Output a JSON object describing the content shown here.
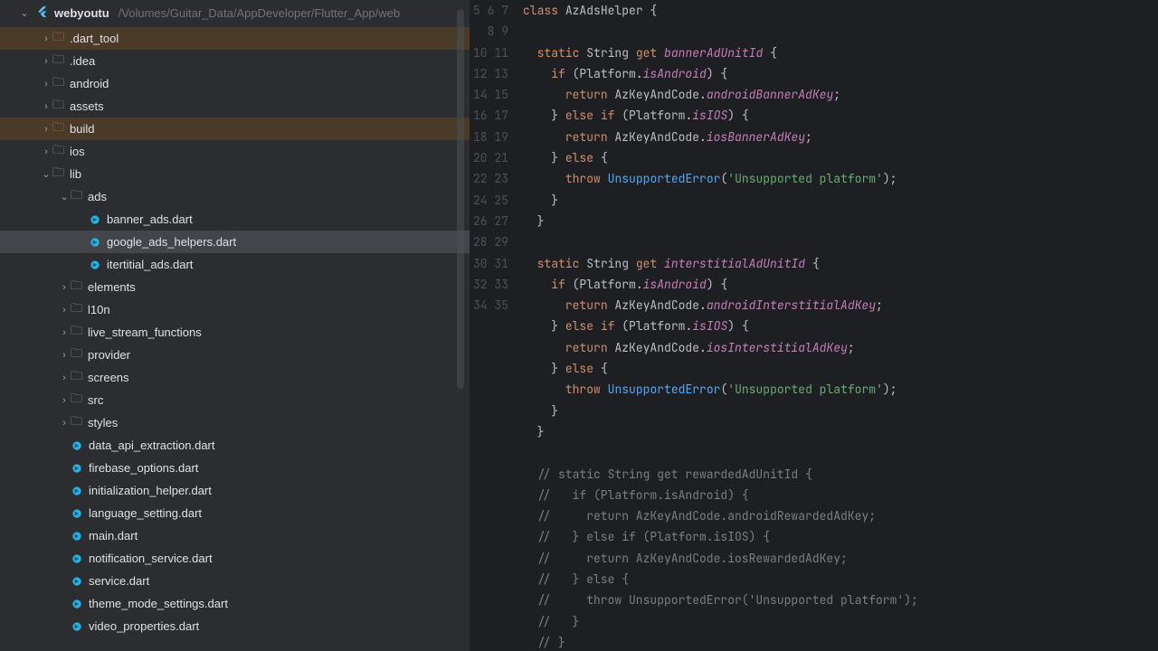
{
  "project": {
    "name": "webyoutu",
    "path": "/Volumes/Guitar_Data/AppDeveloper/Flutter_App/web"
  },
  "tree": [
    {
      "indent": 1,
      "chevron": "right",
      "icon": "folder-orange",
      "label": ".dart_tool",
      "highlight": "orange"
    },
    {
      "indent": 1,
      "chevron": "right",
      "icon": "folder",
      "label": ".idea"
    },
    {
      "indent": 1,
      "chevron": "right",
      "icon": "folder",
      "label": "android"
    },
    {
      "indent": 1,
      "chevron": "right",
      "icon": "folder",
      "label": "assets"
    },
    {
      "indent": 1,
      "chevron": "right",
      "icon": "folder-orange",
      "label": "build",
      "highlight": "orange"
    },
    {
      "indent": 1,
      "chevron": "right",
      "icon": "folder",
      "label": "ios"
    },
    {
      "indent": 1,
      "chevron": "down",
      "icon": "folder",
      "label": "lib"
    },
    {
      "indent": 2,
      "chevron": "down",
      "icon": "folder",
      "label": "ads"
    },
    {
      "indent": 3,
      "chevron": "",
      "icon": "dart",
      "label": "banner_ads.dart"
    },
    {
      "indent": 3,
      "chevron": "",
      "icon": "dart",
      "label": "google_ads_helpers.dart",
      "selected": true
    },
    {
      "indent": 3,
      "chevron": "",
      "icon": "dart",
      "label": "itertitial_ads.dart"
    },
    {
      "indent": 2,
      "chevron": "right",
      "icon": "folder",
      "label": "elements"
    },
    {
      "indent": 2,
      "chevron": "right",
      "icon": "folder",
      "label": "l10n"
    },
    {
      "indent": 2,
      "chevron": "right",
      "icon": "folder",
      "label": "live_stream_functions"
    },
    {
      "indent": 2,
      "chevron": "right",
      "icon": "folder",
      "label": "provider"
    },
    {
      "indent": 2,
      "chevron": "right",
      "icon": "folder",
      "label": "screens"
    },
    {
      "indent": 2,
      "chevron": "right",
      "icon": "folder",
      "label": "src"
    },
    {
      "indent": 2,
      "chevron": "right",
      "icon": "folder",
      "label": "styles"
    },
    {
      "indent": 2,
      "chevron": "",
      "icon": "dart",
      "label": "data_api_extraction.dart"
    },
    {
      "indent": 2,
      "chevron": "",
      "icon": "dart",
      "label": "firebase_options.dart"
    },
    {
      "indent": 2,
      "chevron": "",
      "icon": "dart",
      "label": "initialization_helper.dart"
    },
    {
      "indent": 2,
      "chevron": "",
      "icon": "dart",
      "label": "language_setting.dart"
    },
    {
      "indent": 2,
      "chevron": "",
      "icon": "dart",
      "label": "main.dart"
    },
    {
      "indent": 2,
      "chevron": "",
      "icon": "dart",
      "label": "notification_service.dart"
    },
    {
      "indent": 2,
      "chevron": "",
      "icon": "dart",
      "label": "service.dart"
    },
    {
      "indent": 2,
      "chevron": "",
      "icon": "dart",
      "label": "theme_mode_settings.dart"
    },
    {
      "indent": 2,
      "chevron": "",
      "icon": "dart",
      "label": "video_properties.dart"
    }
  ],
  "gutterStart": 5,
  "gutterEnd": 35,
  "code": [
    [
      [
        "kw",
        "class"
      ],
      [
        "",
        " AzAdsHelper "
      ],
      [
        "punc",
        "{"
      ]
    ],
    [],
    [
      [
        "",
        "  "
      ],
      [
        "kw",
        "static"
      ],
      [
        "",
        " String "
      ],
      [
        "kw",
        "get"
      ],
      [
        "",
        " "
      ],
      [
        "getter",
        "bannerAdUnitId"
      ],
      [
        "",
        " "
      ],
      [
        "punc",
        "{"
      ]
    ],
    [
      [
        "",
        "    "
      ],
      [
        "kw",
        "if"
      ],
      [
        "",
        " (Platform."
      ],
      [
        "member",
        "isAndroid"
      ],
      [
        "punc",
        ") {"
      ]
    ],
    [
      [
        "",
        "      "
      ],
      [
        "kw",
        "return"
      ],
      [
        "",
        " AzKeyAndCode."
      ],
      [
        "member",
        "androidBannerAdKey"
      ],
      [
        "punc",
        ";"
      ]
    ],
    [
      [
        "",
        "    "
      ],
      [
        "punc",
        "}"
      ],
      [
        "",
        " "
      ],
      [
        "kw",
        "else if"
      ],
      [
        "",
        " (Platform."
      ],
      [
        "member",
        "isIOS"
      ],
      [
        "punc",
        ") {"
      ]
    ],
    [
      [
        "",
        "      "
      ],
      [
        "kw",
        "return"
      ],
      [
        "",
        " AzKeyAndCode."
      ],
      [
        "member",
        "iosBannerAdKey"
      ],
      [
        "punc",
        ";"
      ]
    ],
    [
      [
        "",
        "    "
      ],
      [
        "punc",
        "}"
      ],
      [
        "",
        " "
      ],
      [
        "kw",
        "else"
      ],
      [
        "",
        " "
      ],
      [
        "punc",
        "{"
      ]
    ],
    [
      [
        "",
        "      "
      ],
      [
        "kw",
        "throw"
      ],
      [
        "",
        " "
      ],
      [
        "err",
        "UnsupportedError"
      ],
      [
        "punc",
        "("
      ],
      [
        "str",
        "'Unsupported platform'"
      ],
      [
        "punc",
        ");"
      ]
    ],
    [
      [
        "",
        "    "
      ],
      [
        "punc",
        "}"
      ]
    ],
    [
      [
        "",
        "  "
      ],
      [
        "punc",
        "}"
      ]
    ],
    [],
    [
      [
        "",
        "  "
      ],
      [
        "kw",
        "static"
      ],
      [
        "",
        " String "
      ],
      [
        "kw",
        "get"
      ],
      [
        "",
        " "
      ],
      [
        "getter",
        "interstitialAdUnitId"
      ],
      [
        "",
        " "
      ],
      [
        "punc",
        "{"
      ]
    ],
    [
      [
        "",
        "    "
      ],
      [
        "kw",
        "if"
      ],
      [
        "",
        " (Platform."
      ],
      [
        "member",
        "isAndroid"
      ],
      [
        "punc",
        ") {"
      ]
    ],
    [
      [
        "",
        "      "
      ],
      [
        "kw",
        "return"
      ],
      [
        "",
        " AzKeyAndCode."
      ],
      [
        "member",
        "androidInterstitialAdKey"
      ],
      [
        "punc",
        ";"
      ]
    ],
    [
      [
        "",
        "    "
      ],
      [
        "punc",
        "}"
      ],
      [
        "",
        " "
      ],
      [
        "kw",
        "else if"
      ],
      [
        "",
        " (Platform."
      ],
      [
        "member",
        "isIOS"
      ],
      [
        "punc",
        ") {"
      ]
    ],
    [
      [
        "",
        "      "
      ],
      [
        "kw",
        "return"
      ],
      [
        "",
        " AzKeyAndCode."
      ],
      [
        "member",
        "iosInterstitialAdKey"
      ],
      [
        "punc",
        ";"
      ]
    ],
    [
      [
        "",
        "    "
      ],
      [
        "punc",
        "}"
      ],
      [
        "",
        " "
      ],
      [
        "kw",
        "else"
      ],
      [
        "",
        " "
      ],
      [
        "punc",
        "{"
      ]
    ],
    [
      [
        "",
        "      "
      ],
      [
        "kw",
        "throw"
      ],
      [
        "",
        " "
      ],
      [
        "err",
        "UnsupportedError"
      ],
      [
        "punc",
        "("
      ],
      [
        "str",
        "'Unsupported platform'"
      ],
      [
        "punc",
        ");"
      ]
    ],
    [
      [
        "",
        "    "
      ],
      [
        "punc",
        "}"
      ]
    ],
    [
      [
        "",
        "  "
      ],
      [
        "punc",
        "}"
      ]
    ],
    [],
    [
      [
        "cmt",
        "  // static String get rewardedAdUnitId {"
      ]
    ],
    [
      [
        "cmt",
        "  //   if (Platform.isAndroid) {"
      ]
    ],
    [
      [
        "cmt",
        "  //     return AzKeyAndCode.androidRewardedAdKey;"
      ]
    ],
    [
      [
        "cmt",
        "  //   } else if (Platform.isIOS) {"
      ]
    ],
    [
      [
        "cmt",
        "  //     return AzKeyAndCode.iosRewardedAdKey;"
      ]
    ],
    [
      [
        "cmt",
        "  //   } else {"
      ]
    ],
    [
      [
        "cmt",
        "  //     throw UnsupportedError('Unsupported platform');"
      ]
    ],
    [
      [
        "cmt",
        "  //   }"
      ]
    ],
    [
      [
        "cmt",
        "  // }"
      ]
    ]
  ]
}
